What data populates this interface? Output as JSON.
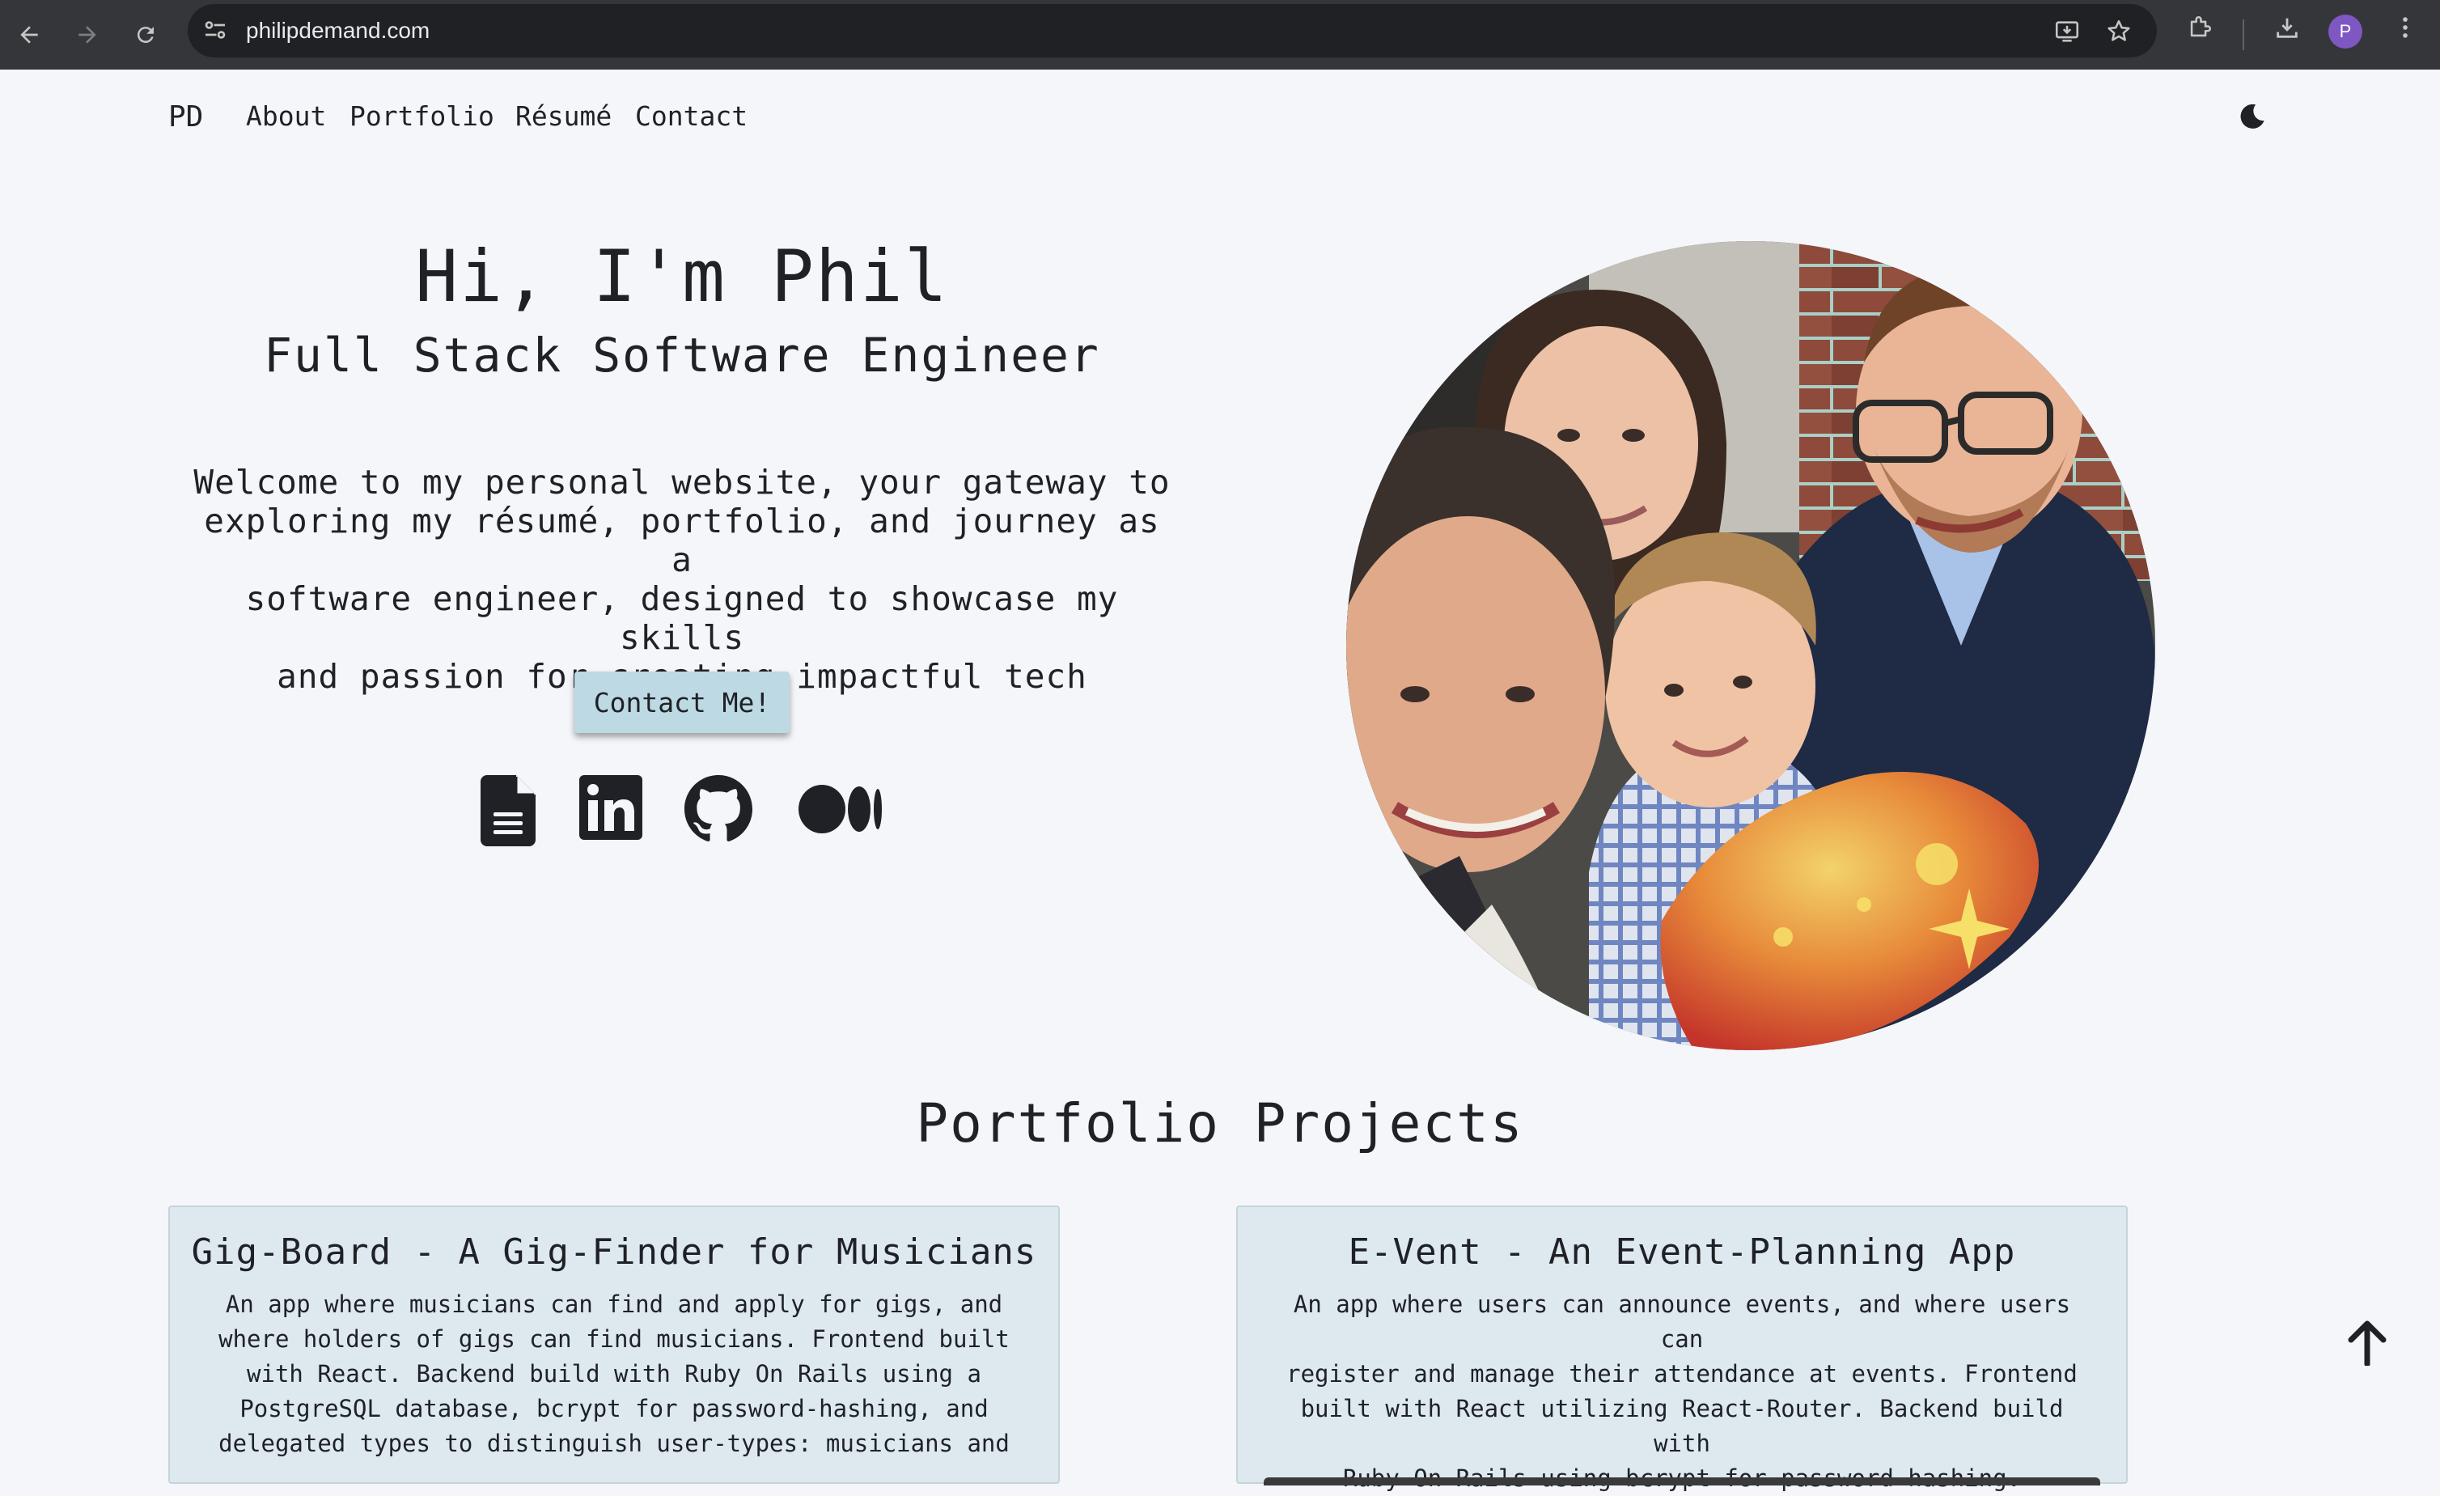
{
  "browser": {
    "url": "philipdemand.com",
    "profile_initial": "P"
  },
  "nav": {
    "logo": "PD",
    "links": [
      "About",
      "Portfolio",
      "Résumé",
      "Contact"
    ]
  },
  "hero": {
    "title": "Hi, I'm Phil",
    "subtitle": "Full Stack Software Engineer",
    "welcome_lines": [
      "Welcome to my personal website, your gateway to",
      "exploring my résumé, portfolio, and journey as a",
      "software engineer, designed to showcase my skills",
      "and passion for creating impactful tech solutions!"
    ],
    "contact_button": "Contact Me!",
    "social_icons": [
      "resume-document-icon",
      "linkedin-icon",
      "github-icon",
      "medium-icon"
    ]
  },
  "portfolio": {
    "title": "Portfolio Projects",
    "projects": [
      {
        "title": "Gig-Board - A Gig-Finder for Musicians",
        "description_lines": [
          "An app where musicians can find and apply for gigs, and",
          "where holders of gigs can find musicians. Frontend built",
          "with React. Backend build with Ruby On Rails using a",
          "PostgreSQL database, bcrypt for password-hashing, and",
          "delegated types to distinguish user-types: musicians and"
        ]
      },
      {
        "title": "E-Vent - An Event-Planning App",
        "description_lines": [
          "An app where users can announce events, and where users can",
          "register and manage their attendance at events. Frontend",
          "built with React utilizing React-Router. Backend build with",
          "Ruby On Rails using bcrypt for password-hashing."
        ]
      }
    ]
  },
  "colors": {
    "page_bg": "#f4f6fa",
    "chrome_bg": "#35363a",
    "card_bg": "#dde9ee",
    "button_bg": "#bdd9e3",
    "text": "#1f2126"
  }
}
